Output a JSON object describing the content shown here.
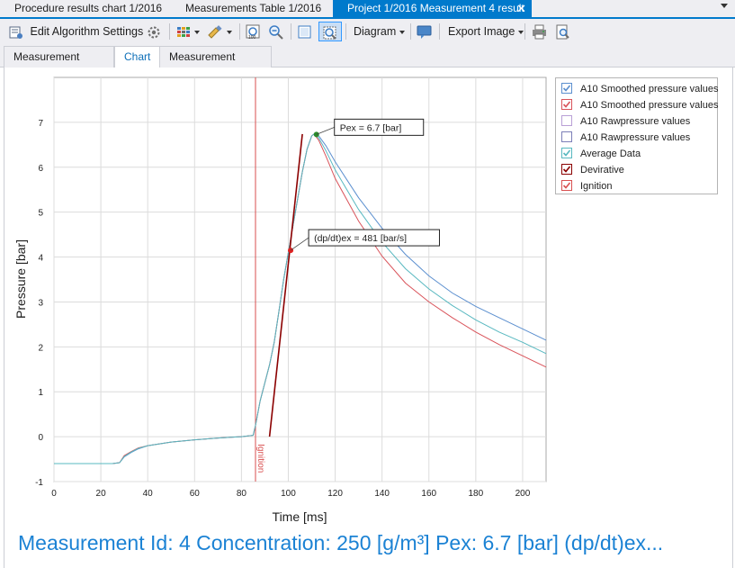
{
  "document_tabs": [
    {
      "label": "Procedure results chart 1/2016"
    },
    {
      "label": "Measurements Table 1/2016"
    },
    {
      "label": "Project 1/2016 Measurement 4 result"
    }
  ],
  "toolbar": {
    "edit_algorithm_label": "Edit Algorithm Settings",
    "diagram_label": "Diagram",
    "export_image_label": "Export Image"
  },
  "view_tabs": [
    {
      "label": "Measurement Details"
    },
    {
      "label": "Chart"
    },
    {
      "label": "Measurement Results"
    }
  ],
  "colors": {
    "accent": "#007acc",
    "series_smoothed_1": "#5b8fcf",
    "series_smoothed_2": "#d9535a",
    "series_average": "#58b8c0",
    "derivative": "#8b0000",
    "ignition": "#d95050",
    "footer": "#1b82d4"
  },
  "chart_data": {
    "type": "line",
    "xlabel": "Time [ms]",
    "ylabel": "Pressure [bar]",
    "xlim": [
      0,
      210
    ],
    "ylim": [
      -1,
      8
    ],
    "x_ticks": [
      0,
      20,
      40,
      60,
      80,
      100,
      120,
      140,
      160,
      180,
      200
    ],
    "y_ticks": [
      -1,
      0,
      1,
      2,
      3,
      4,
      5,
      6,
      7
    ],
    "grid": true,
    "legend_position": "right",
    "legend": [
      {
        "label": "A10 Smoothed pressure values",
        "checked": true,
        "color": "#5b8fcf"
      },
      {
        "label": "A10 Smoothed pressure values",
        "checked": true,
        "color": "#d9535a"
      },
      {
        "label": "A10 Rawpressure values",
        "checked": false,
        "color": "#b9a0d6"
      },
      {
        "label": "A10 Rawpressure values",
        "checked": false,
        "color": "#7c7fb8"
      },
      {
        "label": "Average Data",
        "checked": true,
        "color": "#58b8c0"
      },
      {
        "label": "Devirative",
        "checked": true,
        "color": "#8b0000"
      },
      {
        "label": "Ignition",
        "checked": true,
        "color": "#d95050"
      }
    ],
    "ignition_x": 86,
    "ignition_label": "Ignition",
    "series": [
      {
        "name": "A10 Smoothed pressure values",
        "color": "#5b8fcf",
        "points": [
          [
            0,
            -0.6
          ],
          [
            25,
            -0.6
          ],
          [
            28,
            -0.58
          ],
          [
            30,
            -0.45
          ],
          [
            33,
            -0.35
          ],
          [
            36,
            -0.27
          ],
          [
            40,
            -0.2
          ],
          [
            50,
            -0.12
          ],
          [
            60,
            -0.07
          ],
          [
            70,
            -0.03
          ],
          [
            80,
            0.0
          ],
          [
            85,
            0.03
          ],
          [
            86,
            0.25
          ],
          [
            88,
            0.8
          ],
          [
            90,
            1.2
          ],
          [
            92,
            1.6
          ],
          [
            94,
            2.1
          ],
          [
            96,
            2.8
          ],
          [
            98,
            3.5
          ],
          [
            100,
            4.1
          ],
          [
            102,
            4.7
          ],
          [
            104,
            5.3
          ],
          [
            106,
            5.9
          ],
          [
            108,
            6.4
          ],
          [
            110,
            6.7
          ],
          [
            111,
            6.74
          ],
          [
            113,
            6.7
          ],
          [
            116,
            6.48
          ],
          [
            120,
            6.12
          ],
          [
            130,
            5.32
          ],
          [
            140,
            4.64
          ],
          [
            150,
            4.06
          ],
          [
            160,
            3.58
          ],
          [
            170,
            3.2
          ],
          [
            180,
            2.9
          ],
          [
            190,
            2.65
          ],
          [
            200,
            2.4
          ],
          [
            210,
            2.15
          ]
        ]
      },
      {
        "name": "A10 Smoothed pressure values",
        "color": "#d9535a",
        "points": [
          [
            0,
            -0.6
          ],
          [
            25,
            -0.6
          ],
          [
            28,
            -0.58
          ],
          [
            30,
            -0.42
          ],
          [
            33,
            -0.33
          ],
          [
            36,
            -0.25
          ],
          [
            40,
            -0.2
          ],
          [
            50,
            -0.12
          ],
          [
            60,
            -0.07
          ],
          [
            70,
            -0.03
          ],
          [
            80,
            0.0
          ],
          [
            85,
            0.03
          ],
          [
            86,
            0.25
          ],
          [
            88,
            0.8
          ],
          [
            90,
            1.2
          ],
          [
            92,
            1.6
          ],
          [
            94,
            2.1
          ],
          [
            96,
            2.8
          ],
          [
            98,
            3.5
          ],
          [
            100,
            4.1
          ],
          [
            102,
            4.7
          ],
          [
            104,
            5.3
          ],
          [
            106,
            5.9
          ],
          [
            108,
            6.4
          ],
          [
            110,
            6.7
          ],
          [
            111,
            6.74
          ],
          [
            113,
            6.6
          ],
          [
            116,
            6.25
          ],
          [
            120,
            5.75
          ],
          [
            130,
            4.8
          ],
          [
            140,
            4.02
          ],
          [
            150,
            3.42
          ],
          [
            160,
            3.0
          ],
          [
            170,
            2.65
          ],
          [
            180,
            2.33
          ],
          [
            190,
            2.05
          ],
          [
            200,
            1.8
          ],
          [
            210,
            1.55
          ]
        ]
      },
      {
        "name": "Average Data",
        "color": "#58b8c0",
        "points": [
          [
            0,
            -0.6
          ],
          [
            25,
            -0.6
          ],
          [
            28,
            -0.58
          ],
          [
            30,
            -0.44
          ],
          [
            33,
            -0.34
          ],
          [
            36,
            -0.26
          ],
          [
            40,
            -0.2
          ],
          [
            50,
            -0.12
          ],
          [
            60,
            -0.07
          ],
          [
            70,
            -0.03
          ],
          [
            80,
            0.0
          ],
          [
            85,
            0.03
          ],
          [
            86,
            0.25
          ],
          [
            88,
            0.8
          ],
          [
            90,
            1.2
          ],
          [
            92,
            1.6
          ],
          [
            94,
            2.1
          ],
          [
            96,
            2.8
          ],
          [
            98,
            3.5
          ],
          [
            100,
            4.1
          ],
          [
            102,
            4.7
          ],
          [
            104,
            5.3
          ],
          [
            106,
            5.9
          ],
          [
            108,
            6.4
          ],
          [
            110,
            6.7
          ],
          [
            111,
            6.74
          ],
          [
            113,
            6.65
          ],
          [
            116,
            6.37
          ],
          [
            120,
            5.94
          ],
          [
            130,
            5.06
          ],
          [
            140,
            4.33
          ],
          [
            150,
            3.74
          ],
          [
            160,
            3.29
          ],
          [
            170,
            2.92
          ],
          [
            180,
            2.6
          ],
          [
            190,
            2.33
          ],
          [
            200,
            2.1
          ],
          [
            210,
            1.85
          ]
        ]
      },
      {
        "name": "Devirative",
        "color": "#8b0000",
        "points": [
          [
            92,
            0.0
          ],
          [
            106,
            6.74
          ]
        ]
      }
    ],
    "annotations": [
      {
        "label": "Pex = 6.7 [bar]",
        "x": 112,
        "y": 6.73,
        "marker_color": "#2a8a2a"
      },
      {
        "label": "(dp/dt)ex = 481 [bar/s]",
        "x": 101,
        "y": 4.15,
        "marker_color": "#e02020"
      }
    ]
  },
  "footer_title": "Measurement Id: 4 Concentration: 250 [g/m³] Pex: 6.7 [bar] (dp/dt)ex..."
}
